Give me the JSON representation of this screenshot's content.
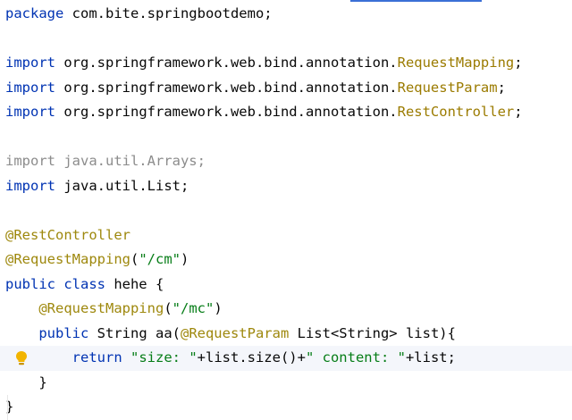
{
  "editor": {
    "lines": [
      {
        "segments": [
          {
            "t": "package",
            "c": "kw"
          },
          {
            "t": " com.bite.springbootdemo;",
            "c": ""
          }
        ]
      },
      {
        "segments": []
      },
      {
        "segments": [
          {
            "t": "import",
            "c": "kw"
          },
          {
            "t": " org.springframework.web.bind.annotation.",
            "c": ""
          },
          {
            "t": "RequestMapping",
            "c": "cls"
          },
          {
            "t": ";",
            "c": ""
          }
        ]
      },
      {
        "segments": [
          {
            "t": "import",
            "c": "kw"
          },
          {
            "t": " org.springframework.web.bind.annotation.",
            "c": ""
          },
          {
            "t": "RequestParam",
            "c": "cls"
          },
          {
            "t": ";",
            "c": ""
          }
        ]
      },
      {
        "segments": [
          {
            "t": "import",
            "c": "kw"
          },
          {
            "t": " org.springframework.web.bind.annotation.",
            "c": ""
          },
          {
            "t": "RestController",
            "c": "cls"
          },
          {
            "t": ";",
            "c": ""
          }
        ]
      },
      {
        "segments": []
      },
      {
        "segments": [
          {
            "t": "import java.util.Arrays;",
            "c": "dim"
          }
        ]
      },
      {
        "segments": [
          {
            "t": "import",
            "c": "kw"
          },
          {
            "t": " java.util.List;",
            "c": ""
          }
        ]
      },
      {
        "segments": []
      },
      {
        "segments": [
          {
            "t": "@RestController",
            "c": "ann"
          }
        ]
      },
      {
        "segments": [
          {
            "t": "@RequestMapping",
            "c": "ann"
          },
          {
            "t": "(",
            "c": ""
          },
          {
            "t": "\"/cm\"",
            "c": "str"
          },
          {
            "t": ")",
            "c": ""
          }
        ]
      },
      {
        "segments": [
          {
            "t": "public class",
            "c": "kw"
          },
          {
            "t": " hehe {",
            "c": ""
          }
        ]
      },
      {
        "segments": [
          {
            "t": "    ",
            "c": ""
          },
          {
            "t": "@RequestMapping",
            "c": "ann"
          },
          {
            "t": "(",
            "c": ""
          },
          {
            "t": "\"/mc\"",
            "c": "str"
          },
          {
            "t": ")",
            "c": ""
          }
        ]
      },
      {
        "segments": [
          {
            "t": "    ",
            "c": ""
          },
          {
            "t": "public",
            "c": "kw"
          },
          {
            "t": " String aa(",
            "c": ""
          },
          {
            "t": "@RequestParam",
            "c": "ann"
          },
          {
            "t": " List<String> list){",
            "c": ""
          }
        ]
      },
      {
        "segments": [
          {
            "t": "        ",
            "c": ""
          },
          {
            "t": "return",
            "c": "kw"
          },
          {
            "t": " ",
            "c": ""
          },
          {
            "t": "\"size: \"",
            "c": "str"
          },
          {
            "t": "+list.size()+",
            "c": ""
          },
          {
            "t": "\" content: \"",
            "c": "str"
          },
          {
            "t": "+list;",
            "c": ""
          }
        ],
        "current": true,
        "gutter_icon": "lightbulb-icon"
      },
      {
        "segments": [
          {
            "t": "    }",
            "c": ""
          }
        ]
      },
      {
        "segments": [
          {
            "t": "}",
            "c": ""
          }
        ]
      }
    ]
  },
  "colors": {
    "keyword": "#0033b3",
    "class_ref": "#9b7b00",
    "annotation": "#9e880d",
    "string": "#067d17",
    "unused": "#8c8c8c",
    "text": "#080808",
    "current_line": "#f4f6fb",
    "accent": "#3b6fd6"
  }
}
